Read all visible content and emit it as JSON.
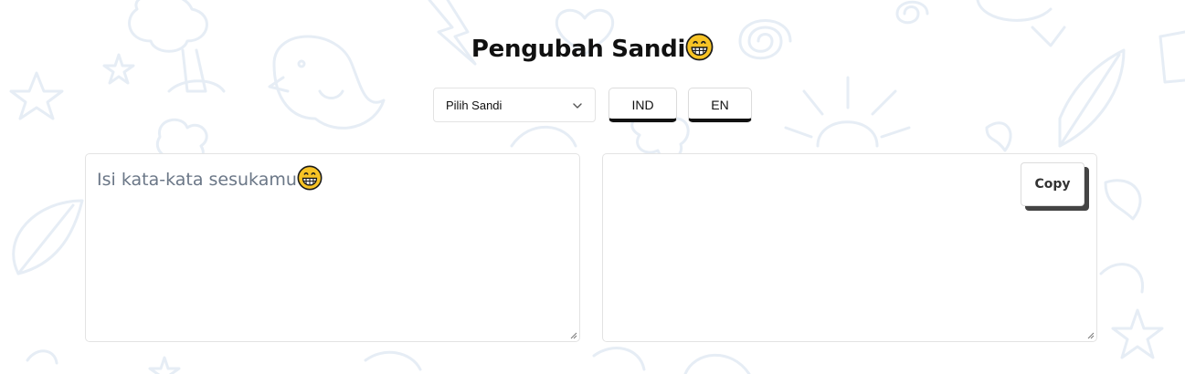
{
  "header": {
    "title": "Pengubah Sandi",
    "title_emoji": "grinning-face-icon"
  },
  "controls": {
    "select_value": "Pilih Sandi",
    "lang_ind_label": "IND",
    "lang_en_label": "EN"
  },
  "input": {
    "placeholder": "Isi kata-kata sesukamu",
    "placeholder_emoji": "grinning-face-icon",
    "value": ""
  },
  "output": {
    "value": "",
    "copy_label": "Copy"
  },
  "colors": {
    "background": "#ffffff",
    "doodle_stroke": "#e6edf5",
    "button_border_bottom": "#111111",
    "copy_shadow": "#444444",
    "placeholder_text": "#6b7787"
  }
}
